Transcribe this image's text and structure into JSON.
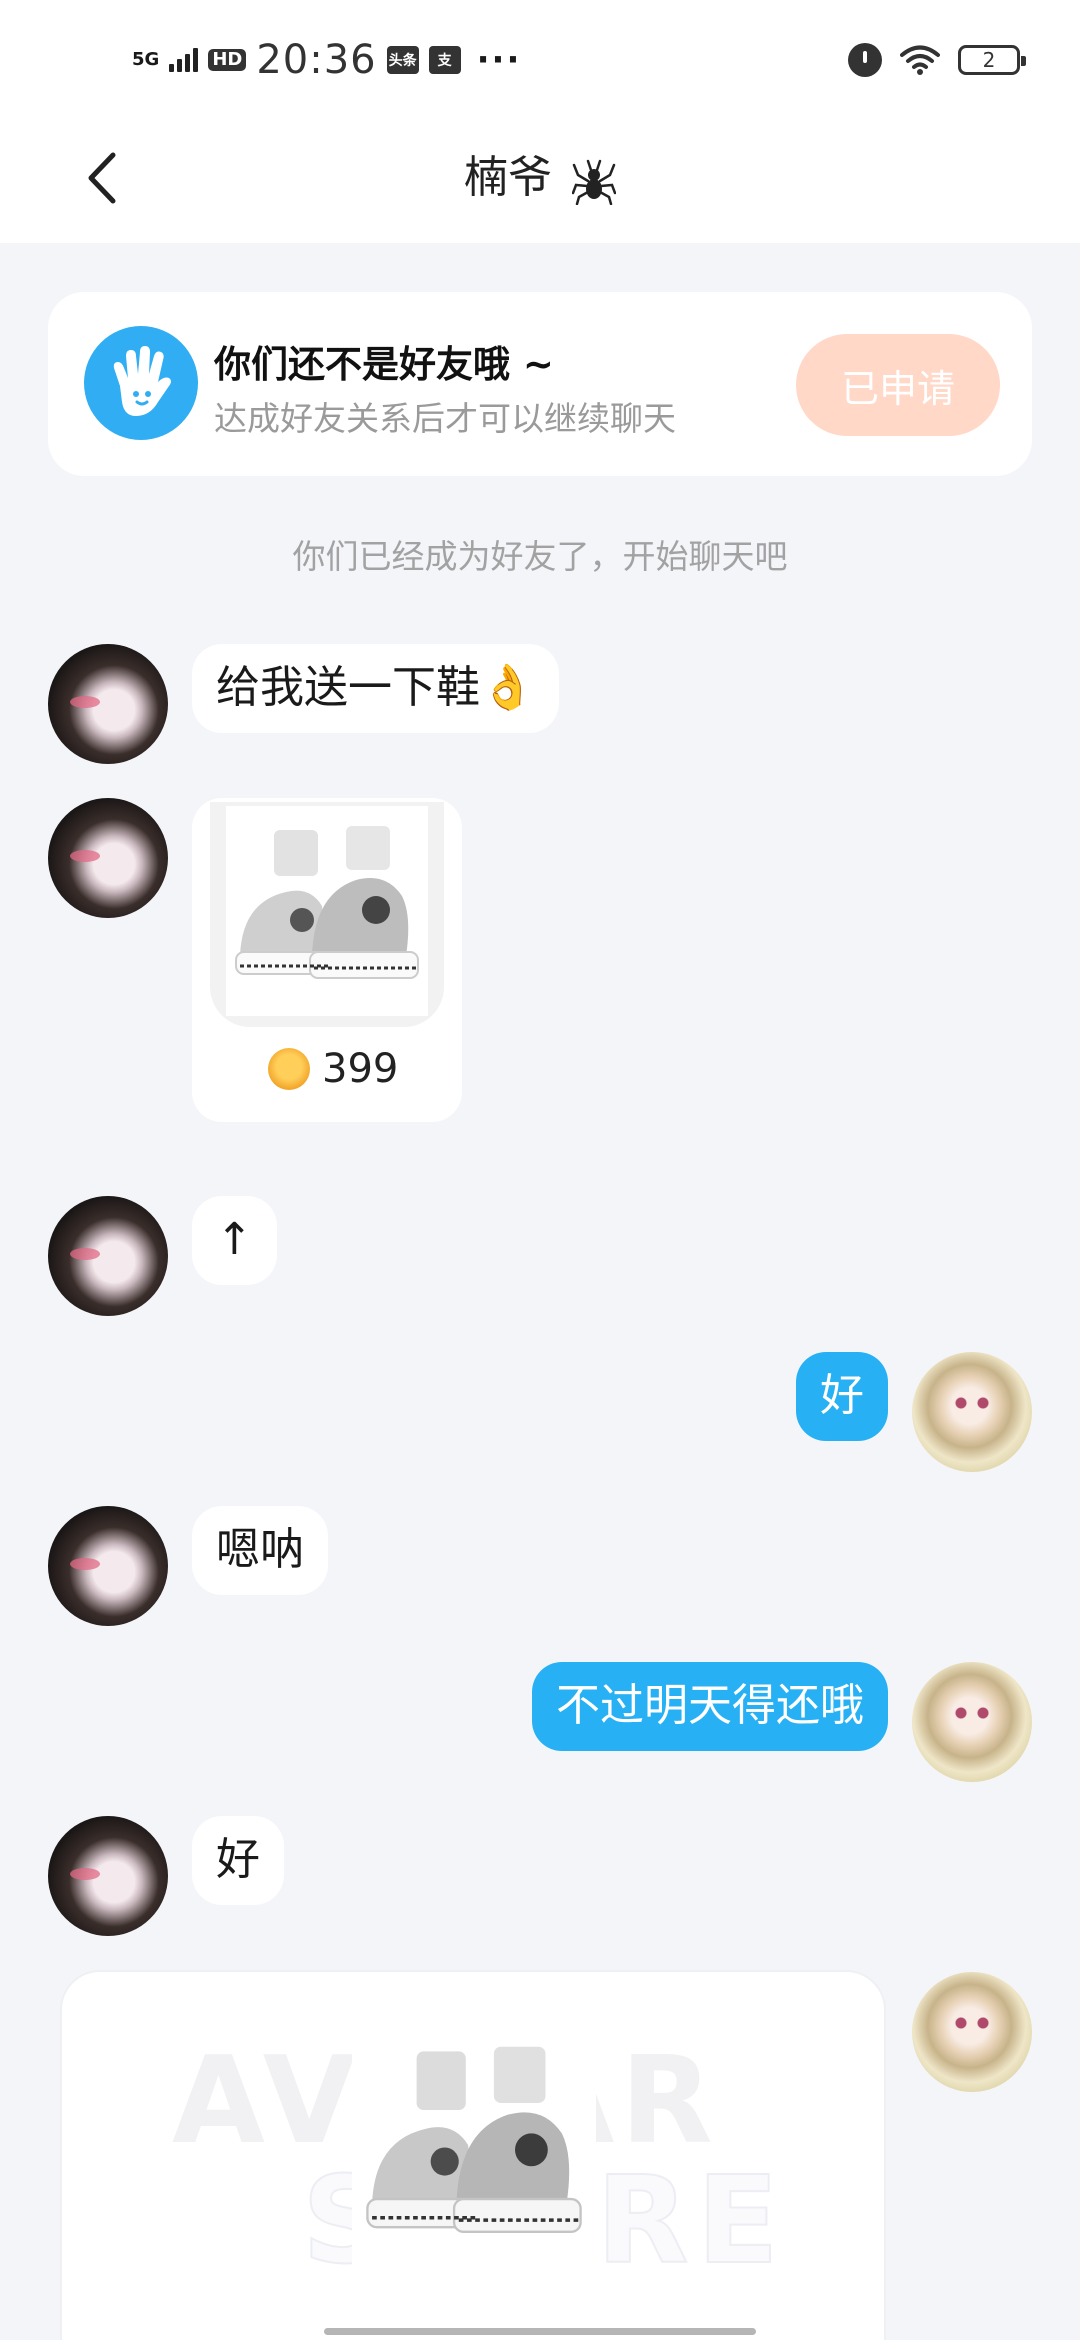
{
  "status_bar": {
    "network": "5G",
    "hd": "HD",
    "time": "20:36",
    "app1": "头条",
    "app2": "支",
    "more": "···",
    "battery": "2"
  },
  "header": {
    "title": "楠爷"
  },
  "friend_card": {
    "title": "你们还不是好友哦 ~",
    "subtitle": "达成好友关系后才可以继续聊天",
    "button": "已申请"
  },
  "system_note": "你们已经成为好友了，开始聊天吧",
  "messages": [
    {
      "from": "other",
      "text": "给我送一下鞋👌"
    },
    {
      "from": "other",
      "type": "gift",
      "price": "399"
    },
    {
      "from": "other",
      "text": "↑"
    },
    {
      "from": "me",
      "text": "好"
    },
    {
      "from": "other",
      "text": "嗯呐"
    },
    {
      "from": "me",
      "text": "不过明天得还哦"
    },
    {
      "from": "other",
      "text": "好"
    },
    {
      "from": "me",
      "type": "gift-card",
      "watermark1": "AVATAR",
      "watermark2": "STORE"
    }
  ],
  "colors": {
    "accent": "#27b1f4",
    "button": "#ffd8c8",
    "background": "#f3f5f9"
  }
}
